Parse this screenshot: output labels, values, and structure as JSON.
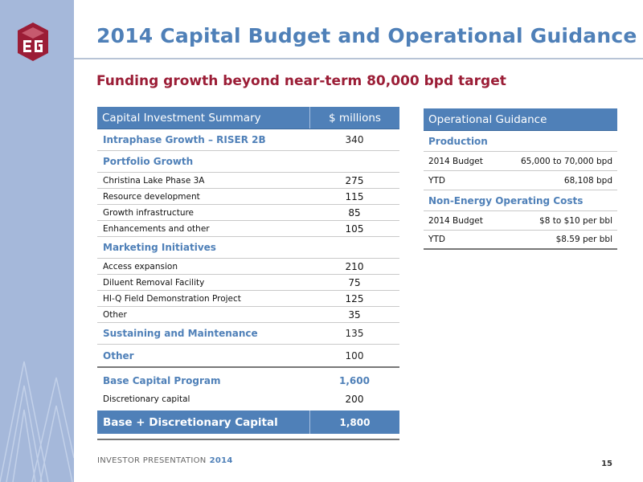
{
  "slide": {
    "title": "2014 Capital Budget and Operational Guidance",
    "subtitle": "Funding growth beyond near-term 80,000 bpd target",
    "footer_label": "INVESTOR PRESENTATION",
    "footer_year": "2014",
    "page_number": "15"
  },
  "colors": {
    "accent_blue": "#4f80b8",
    "accent_red": "#9b1d36",
    "side_band": "#a5b8da"
  },
  "capital_table": {
    "header": [
      "Capital Investment Summary",
      "$ millions"
    ],
    "rows": [
      {
        "label": "Intraphase Growth – RISER 2B",
        "value": "340",
        "kind": "sec"
      },
      {
        "label": "Portfolio Growth",
        "value": "",
        "kind": "sec"
      },
      {
        "label": "Christina Lake Phase 3A",
        "value": "275",
        "kind": "item"
      },
      {
        "label": "Resource development",
        "value": "115",
        "kind": "item"
      },
      {
        "label": "Growth infrastructure",
        "value": "85",
        "kind": "item"
      },
      {
        "label": "Enhancements and other",
        "value": "105",
        "kind": "item"
      },
      {
        "label": "Marketing Initiatives",
        "value": "",
        "kind": "sec"
      },
      {
        "label": "Access expansion",
        "value": "210",
        "kind": "item"
      },
      {
        "label": "Diluent Removal Facility",
        "value": "75",
        "kind": "item"
      },
      {
        "label": "HI-Q Field Demonstration Project",
        "value": "125",
        "kind": "item"
      },
      {
        "label": "Other",
        "value": "35",
        "kind": "item"
      },
      {
        "label": "Sustaining and Maintenance",
        "value": "135",
        "kind": "sec"
      },
      {
        "label": "Other",
        "value": "100",
        "kind": "sec"
      }
    ],
    "base_label": "Base Capital Program",
    "base_value": "1,600",
    "discretionary_label": "Discretionary capital",
    "discretionary_value": "200",
    "total_label": "Base + Discretionary Capital",
    "total_value": "1,800"
  },
  "operational_table": {
    "header": "Operational Guidance",
    "sections": [
      {
        "title": "Production",
        "rows": [
          {
            "label": "2014 Budget",
            "value": "65,000 to 70,000 bpd"
          },
          {
            "label": "YTD",
            "value": "68,108 bpd"
          }
        ]
      },
      {
        "title": "Non-Energy Operating Costs",
        "rows": [
          {
            "label": "2014 Budget",
            "value": "$8 to $10 per bbl"
          },
          {
            "label": "YTD",
            "value": "$8.59 per bbl"
          }
        ]
      }
    ]
  }
}
